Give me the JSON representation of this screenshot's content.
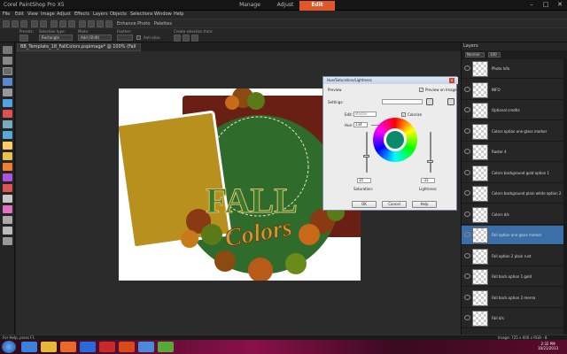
{
  "app": {
    "title": "Corel PaintShop Pro X5"
  },
  "workspace_tabs": [
    {
      "label": "Manage",
      "active": false
    },
    {
      "label": "Adjust",
      "active": false
    },
    {
      "label": "Edit",
      "active": true
    }
  ],
  "menu": [
    "File",
    "Edit",
    "View",
    "Image",
    "Adjust",
    "Effects",
    "Layers",
    "Objects",
    "Selections",
    "Window",
    "Help"
  ],
  "toolbar": {
    "enhance_photo": "Enhance Photo",
    "palettes": "Palettes"
  },
  "tool_options": {
    "presets_label": "Presets:",
    "selection_type_label": "Selection type:",
    "selection_type_value": "Rectangle",
    "mode_label": "Mode:",
    "mode_value": "Add (Shift)",
    "feather_label": "Feather:",
    "antialias_label": "Anti-alias",
    "create_selection_label": "Create selection from:"
  },
  "document": {
    "tab_label": "BB_Template_18_FallColors.pspimage* @ 100% (Fall ..."
  },
  "layers_palette": {
    "title": "Layers",
    "blend_mode": "Normal",
    "opacity": "100",
    "layers": [
      {
        "name": "Photo Info",
        "selected": false
      },
      {
        "name": "INFO",
        "selected": false
      },
      {
        "name": "Optional credits",
        "selected": false
      },
      {
        "name": "Colors option one glass marker",
        "selected": false
      },
      {
        "name": "Raster 4",
        "selected": false
      },
      {
        "name": "Colors background gold option 1",
        "selected": false
      },
      {
        "name": "Colors background plain white option 2",
        "selected": false
      },
      {
        "name": "Colors d/s",
        "selected": false
      },
      {
        "name": "Fall option one glass marker",
        "selected": true
      },
      {
        "name": "Fall option 2 plain rust",
        "selected": false
      },
      {
        "name": "Fall back option 1 gold",
        "selected": false
      },
      {
        "name": "Fall back option 2 merna",
        "selected": false
      },
      {
        "name": "Fall d/s",
        "selected": false
      }
    ]
  },
  "dialog": {
    "title": "Hue/Saturation/Lightness",
    "preview_label": "Preview",
    "preview_on_image_label": "Preview on Image",
    "settings_label": "Settings:",
    "edit_label": "Edit:",
    "edit_value": "Master",
    "colorize_label": "Colorize",
    "hue_label": "Hue:",
    "hue_value": "134",
    "saturation_value": "35",
    "saturation_label": "Saturation:",
    "lightness_value": "-33",
    "lightness_label": "Lightness:",
    "ok_label": "OK",
    "cancel_label": "Cancel",
    "help_label": "Help"
  },
  "canvas_art": {
    "word_one": "FALL",
    "word_two": "Colors"
  },
  "status": {
    "help_text": "For Help, press F1",
    "image_info": "Image: 725 x 600 x RGB - 8 bits/channel"
  },
  "clock": {
    "time": "2:32 PM",
    "date": "10/21/2013"
  },
  "colors": {
    "accent_tab": "#e0572a",
    "canvas_gold": "#b8901e",
    "canvas_green": "#2f6b2a",
    "canvas_maroon": "#6a1f14",
    "layer_selected": "#3b6fa8"
  }
}
